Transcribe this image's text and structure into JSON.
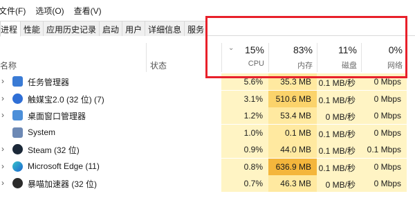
{
  "menu": [
    "文件(F)",
    "选项(O)",
    "查看(V)"
  ],
  "tabs": [
    "进程",
    "性能",
    "应用历史记录",
    "启动",
    "用户",
    "详细信息",
    "服务"
  ],
  "header": {
    "name_label": "名称",
    "status_label": "状态",
    "sort_glyph": "⌄",
    "metrics": [
      {
        "pct": "15%",
        "label": "CPU"
      },
      {
        "pct": "83%",
        "label": "内存"
      },
      {
        "pct": "11%",
        "label": "磁盘"
      },
      {
        "pct": "0%",
        "label": "网络"
      }
    ]
  },
  "rows": [
    {
      "name": "任务管理器",
      "icon": "task-manager-icon",
      "cpu": "5.6%",
      "mem": "35.3 MB",
      "disk": "0.1 MB/秒",
      "net": "0 Mbps"
    },
    {
      "name": "触媒宝2.0 (32 位) (7)",
      "icon": "app-icon",
      "cpu": "3.1%",
      "mem": "510.6 MB",
      "disk": "0.1 MB/秒",
      "net": "0 Mbps"
    },
    {
      "name": "桌面窗口管理器",
      "icon": "window-icon",
      "cpu": "1.2%",
      "mem": "53.4 MB",
      "disk": "0 MB/秒",
      "net": "0 Mbps"
    },
    {
      "name": "System",
      "icon": "system-icon",
      "cpu": "1.0%",
      "mem": "0.1 MB",
      "disk": "0.1 MB/秒",
      "net": "0 Mbps"
    },
    {
      "name": "Steam (32 位)",
      "icon": "steam-icon",
      "cpu": "0.9%",
      "mem": "44.0 MB",
      "disk": "0.1 MB/秒",
      "net": "0.1 Mbps"
    },
    {
      "name": "Microsoft Edge (11)",
      "icon": "edge-icon",
      "cpu": "0.8%",
      "mem": "636.9 MB",
      "disk": "0.1 MB/秒",
      "net": "0 Mbps"
    },
    {
      "name": "暴喵加速器 (32 位)",
      "icon": "accelerator-icon",
      "cpu": "0.7%",
      "mem": "46.3 MB",
      "disk": "0 MB/秒",
      "net": "0 Mbps"
    }
  ],
  "colors": {
    "cell_light": "#fff4c4",
    "cell_mid": "#ffe9a0",
    "cell_strong": "#fbd36b",
    "highlight_border": "#e8202a"
  }
}
